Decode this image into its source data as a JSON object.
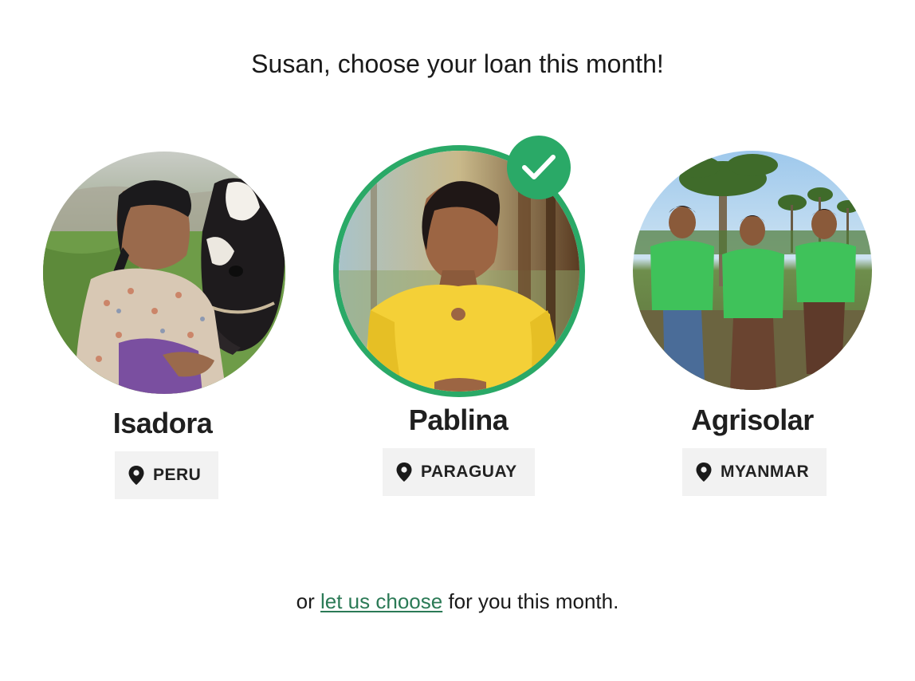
{
  "header": {
    "title": "Susan, choose your loan this month!"
  },
  "borrowers": [
    {
      "name": "Isadora",
      "country": "PERU",
      "selected": false,
      "photo": "elderly-woman-with-calf-photo"
    },
    {
      "name": "Pablina",
      "country": "PARAGUAY",
      "selected": true,
      "photo": "woman-in-yellow-dress-photo"
    },
    {
      "name": "Agrisolar",
      "country": "MYANMAR",
      "selected": false,
      "photo": "three-men-in-green-shirts-photo"
    }
  ],
  "footer": {
    "prefix": "or",
    "link": "let us choose",
    "suffix": "for you this month."
  },
  "colors": {
    "accent": "#2aa967",
    "link": "#2b7a56",
    "badge_bg": "#f2f2f2"
  },
  "icons": {
    "selected": "checkmark-icon",
    "location": "map-pin-icon"
  }
}
